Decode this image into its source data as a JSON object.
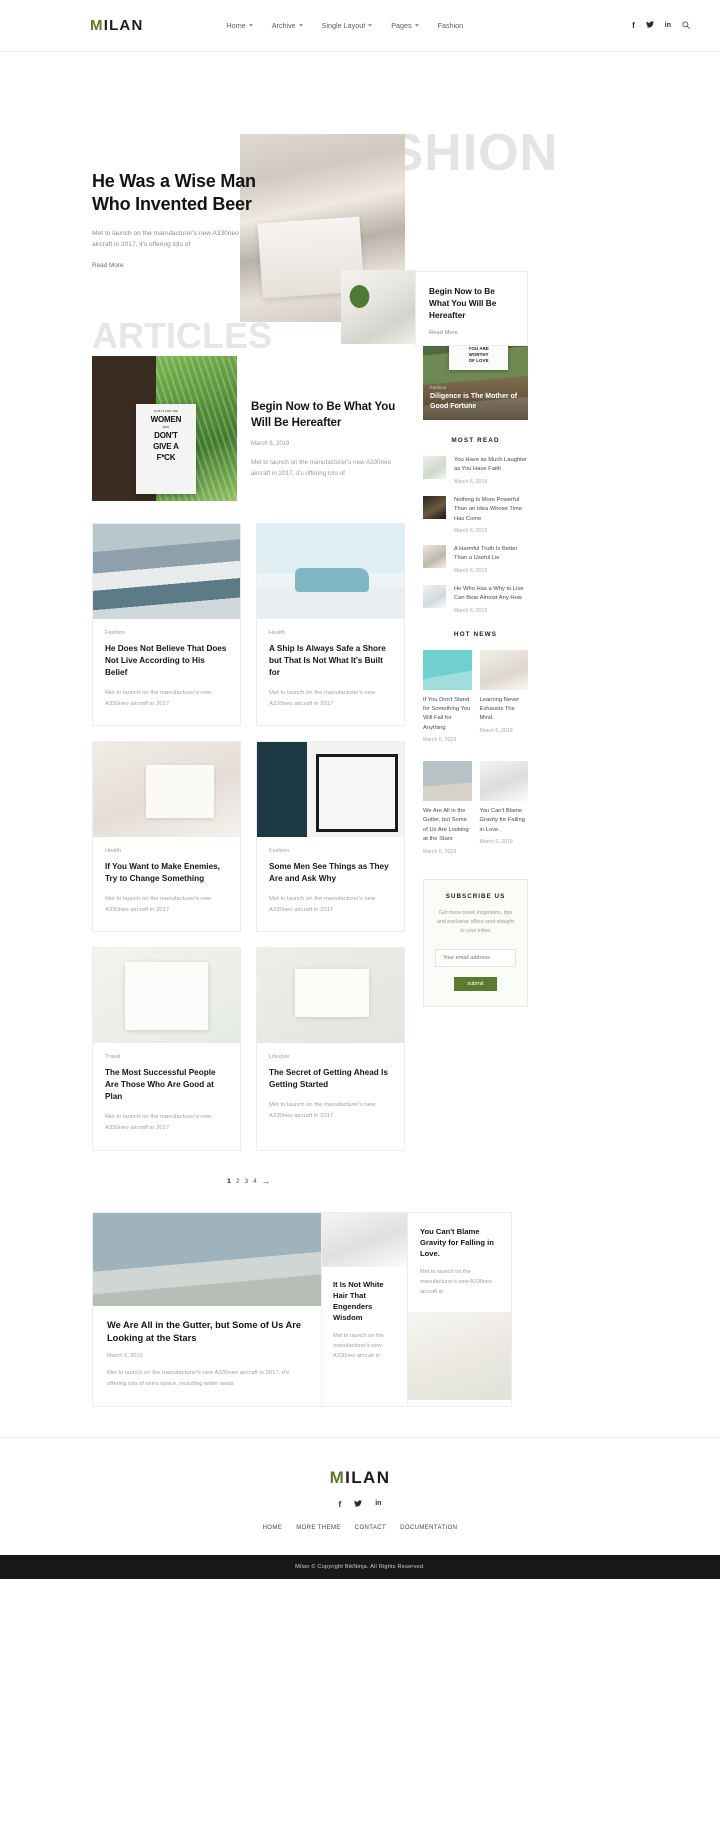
{
  "header": {
    "logo": "MILAN",
    "nav": [
      {
        "label": "Home",
        "has_caret": true
      },
      {
        "label": "Archive",
        "has_caret": true
      },
      {
        "label": "Single Layout",
        "has_caret": true
      },
      {
        "label": "Pages",
        "has_caret": true
      },
      {
        "label": "Fashion",
        "has_caret": false
      }
    ],
    "social": [
      {
        "name": "facebook-icon",
        "glyph": "f"
      },
      {
        "name": "twitter-icon",
        "glyph": "✒"
      },
      {
        "name": "linkedin-icon",
        "glyph": "in"
      }
    ],
    "search_icon": "⚲"
  },
  "hero": {
    "background_word": "FASHION",
    "title": "He Was a Wise Man Who Invented Beer",
    "description": "Met to launch on the manufacturer's new A330neo aircraft in 2017, it's offering lots of",
    "read_more": "Read More",
    "card": {
      "title": "Begin Now to Be What You Will Be Hereafter",
      "read_more": "Read More"
    }
  },
  "articles": {
    "background_word": "ARTICLES",
    "featured": {
      "poster_line1": "THIS IS FOR THE",
      "poster_line2": "WOMEN",
      "poster_line3": "WHO",
      "poster_line4": "DON'T",
      "poster_line5": "GIVE A",
      "poster_line6": "F*CK",
      "title": "Begin Now to Be What You Will Be Hereafter",
      "date": "March 6, 2019",
      "description": "Met to launch on the manufacturer's new A330neo aircraft in 2017, it's offering lots of"
    },
    "cards": [
      {
        "category": "Fashion",
        "title": "He Does Not Believe That Does Not Live According to His Belief",
        "description": "Met to launch on the manufacturer's new A330neo aircraft in 2017"
      },
      {
        "category": "Health",
        "title": "A Ship Is Always Safe a Shore but That Is Not What It's Built for",
        "description": "Met to launch on the manufacturer's new A330neo aircraft in 2017"
      },
      {
        "category": "Health",
        "title": "If You Want to Make Enemies, Try to Change Something",
        "description": "Met to launch on the manufacturer's new A330neo aircraft in 2017"
      },
      {
        "category": "Fashion",
        "title": "Some Men See Things as They Are and Ask Why",
        "description": "Met to launch on the manufacturer's new A330neo aircraft in 2017"
      },
      {
        "category": "Travel",
        "title": "The Most Successful People Are Those Who Are Good at Plan",
        "description": "Met to launch on the manufacturer's new A330neo aircraft in 2017"
      },
      {
        "category": "Lifestyle",
        "title": "The Secret of Getting Ahead Is Getting Started",
        "description": "Met to launch on the manufacturer's new A330neo aircraft in 2017"
      }
    ],
    "pagination": {
      "pages": [
        "1",
        "2",
        "3",
        "4"
      ],
      "active": "1",
      "next_arrow": "→"
    }
  },
  "sidebar": {
    "feature": {
      "sign_line1": "YOU ARE",
      "sign_line2": "WORTHY",
      "sign_line3": "OF LOVE",
      "category": "Fashion",
      "title": "Diligence is The Mother of Good Fortune"
    },
    "most_read": {
      "heading": "MOST READ",
      "items": [
        {
          "title": "You Have as Much Laughter as You Have Faith",
          "date": "March 6, 2019"
        },
        {
          "title": "Nothing Is More Powerful Than an Idea Whose Time Has Come",
          "date": "March 6, 2019"
        },
        {
          "title": "A Harmful Truth Is Better Than a Useful Lie",
          "date": "March 6, 2019"
        },
        {
          "title": "He Who Has a Why to Live Can Bear Almost Any How",
          "date": "March 6, 2019"
        }
      ]
    },
    "hot_news": {
      "heading": "HOT NEWS",
      "items": [
        {
          "title": "If You Don't Stand for Something You Will Fail for Anything",
          "date": "March 6, 2019"
        },
        {
          "title": "Learning Never Exhausts The Mind.",
          "date": "March 6, 2019"
        },
        {
          "title": "We Are All in the Gutter, but Some of Us Are Looking at the Stars",
          "date": "March 6, 2019"
        },
        {
          "title": "You Can't Blame Gravity for Falling in Love.",
          "date": "March 6, 2019"
        }
      ]
    },
    "subscribe": {
      "heading": "SUBSCRIBE US",
      "description": "Get more travel inspiration, tips and exclusive offers sent straight to your inbox",
      "placeholder": "Your email address",
      "button": "submit",
      "button_color": "#5c7a2f"
    }
  },
  "bottom_feature": {
    "big": {
      "title": "We Are All in the Gutter, but Some of Us Are Looking at the Stars",
      "date": "March 6, 2019",
      "description": "Met to launch on the manufacturer's new A330neo aircraft in 2017, it's offering lots of extra space, including wider seats"
    },
    "mid": {
      "title": "It Is Not White Hair That Engenders Wisdom",
      "description": "Met to launch on the manufacturer's new A330neo aircraft in"
    },
    "right": {
      "title": "You Can't Blame Gravity for Falling in Love.",
      "description": "Met to launch on the manufacturer's new A330neo aircraft in"
    }
  },
  "footer": {
    "logo": "MILAN",
    "social": [
      {
        "name": "facebook-icon",
        "glyph": "f"
      },
      {
        "name": "twitter-icon",
        "glyph": "✒"
      },
      {
        "name": "linkedin-icon",
        "glyph": "in"
      }
    ],
    "nav": [
      "HOME",
      "MORE THEME",
      "CONTACT",
      "DOCUMENTATION"
    ],
    "copyright": "Milan © Copyright BikNinja. All Rights Reserved."
  }
}
